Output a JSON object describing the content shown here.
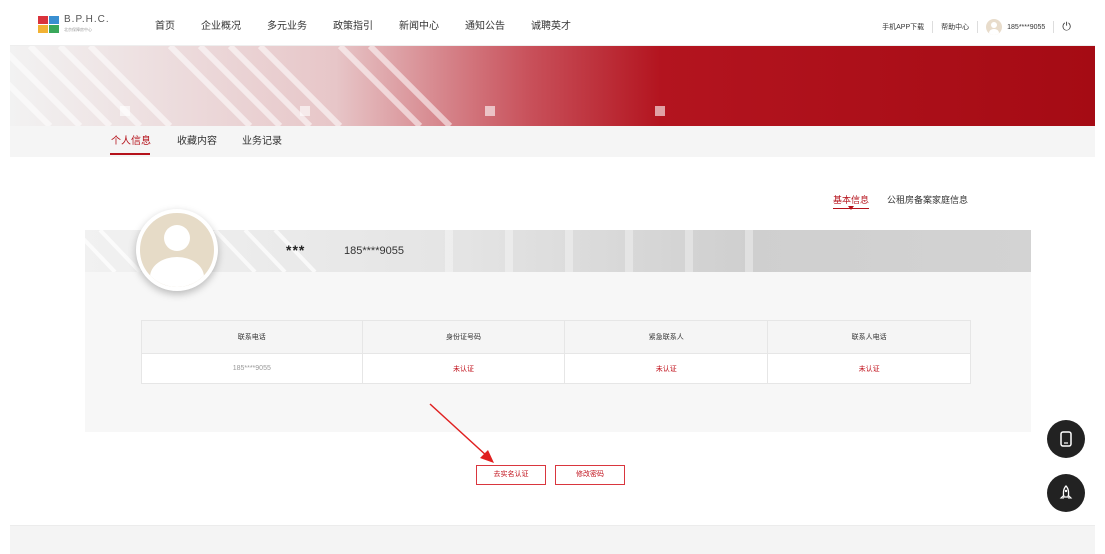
{
  "brand": {
    "name": "B.P.H.C.",
    "subtitle": "北京保障房中心"
  },
  "nav": {
    "items": [
      "首页",
      "企业概况",
      "多元业务",
      "政策指引",
      "新闻中心",
      "通知公告",
      "诚聘英才"
    ]
  },
  "topbar": {
    "app_download": "手机APP下载",
    "help": "帮助中心",
    "user_phone": "185****9055"
  },
  "tabs": [
    "个人信息",
    "收藏内容",
    "业务记录"
  ],
  "subtabs": [
    "基本信息",
    "公租房备案家庭信息"
  ],
  "profile": {
    "name": "***",
    "phone": "185****9055"
  },
  "table": {
    "headers": [
      "联系电话",
      "身份证号码",
      "紧急联系人",
      "联系人电话"
    ],
    "row": [
      "185****9055",
      "未认证",
      "未认证",
      "未认证"
    ]
  },
  "buttons": {
    "verify": "去实名认证",
    "change_password": "修改密码"
  },
  "colors": {
    "accent": "#b5121b",
    "banner_red": "#a50b14"
  },
  "icons": {
    "logout": "power-icon",
    "app": "tablet-icon",
    "top": "rocket-icon"
  }
}
